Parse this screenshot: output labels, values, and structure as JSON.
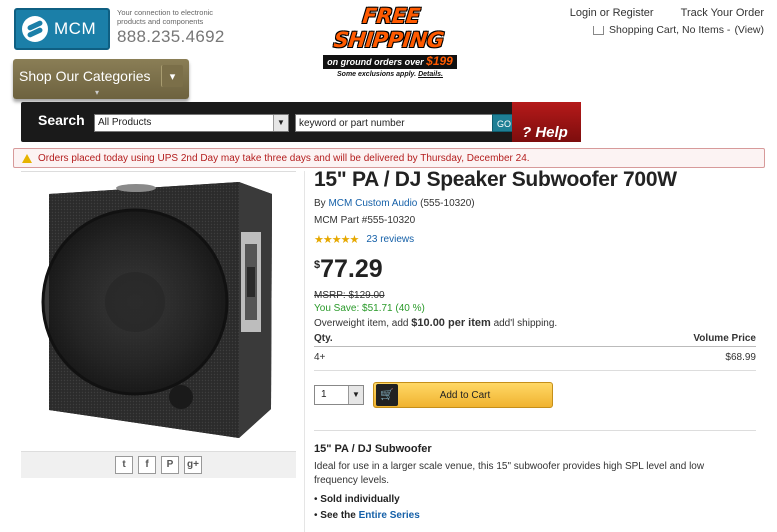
{
  "header": {
    "logo_text": "MCM",
    "tagline": "Your connection to electronic products and components",
    "phone": "888.235.4692",
    "promo": {
      "main": "FREE SHIPPING",
      "sub_prefix": "on ground orders over",
      "amount": "$199",
      "note_prefix": "Some exclusions apply.",
      "note_link": "Details."
    },
    "links": {
      "login": "Login or Register",
      "track": "Track Your Order"
    },
    "cart": {
      "text": "Shopping Cart, No Items -",
      "view": "(View)"
    }
  },
  "nav": {
    "categories_label": "Shop Our Categories",
    "search_label": "Search",
    "category_select": "All Products",
    "keyword_placeholder": "keyword or part number",
    "go_label": "GO",
    "help_label": "Help"
  },
  "alert": "Orders placed today using UPS 2nd Day may take three days and will be delivered by Thursday, December 24.",
  "share": [
    "twitter-icon",
    "facebook-icon",
    "pinterest-icon",
    "googleplus-icon"
  ],
  "product": {
    "title": "15\" PA / DJ Speaker Subwoofer 700W",
    "by_prefix": "By",
    "brand": "MCM Custom Audio",
    "brand_code": "(555-10320)",
    "part": "MCM Part #555-10320",
    "rating": 4.5,
    "reviews": "23 reviews",
    "price_symbol": "$",
    "price_value": "77.29",
    "msrp": "MSRP: $129.00",
    "save": "You Save: $51.71 (40 %)",
    "overweight_prefix": "Overweight item, add",
    "overweight_amount": "$10.00 per item",
    "overweight_suffix": "add'l shipping.",
    "volume": {
      "qty_header": "Qty.",
      "price_header": "Volume Price",
      "rows": [
        {
          "qty": "4+",
          "price": "$68.99"
        }
      ]
    },
    "qty_value": "1",
    "add_to_cart": "Add to Cart",
    "desc_title": "15\" PA / DJ Subwoofer",
    "desc": "Ideal for use in a larger scale venue, this 15\" subwoofer provides high SPL level and low frequency levels.",
    "bullet1": "Sold individually",
    "bullet2_prefix": "See the",
    "bullet2_link": "Entire Series"
  }
}
